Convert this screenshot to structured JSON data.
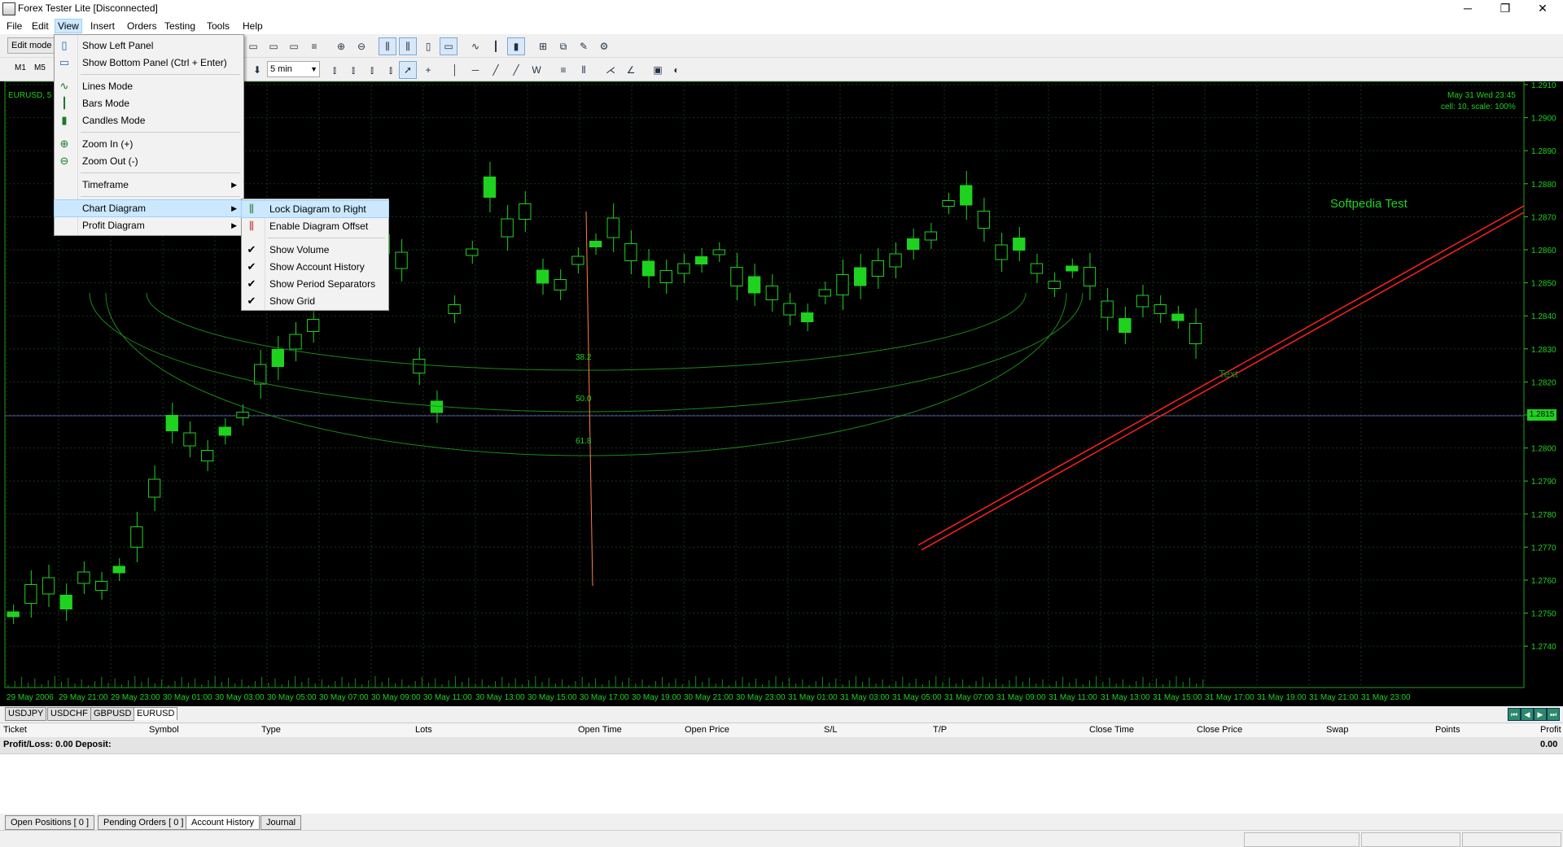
{
  "window": {
    "title": "Forex Tester Lite [Disconnected]",
    "min": "─",
    "max": "❐",
    "close": "✕"
  },
  "menubar": [
    "File",
    "Edit",
    "View",
    "Insert",
    "Orders",
    "Testing",
    "Tools",
    "Help"
  ],
  "toolbar": {
    "edit_mode": "Edit mode",
    "timeframes": [
      "M1",
      "M5"
    ],
    "timeframe_select": "5 min"
  },
  "view_menu": [
    {
      "label": "Show Left Panel",
      "icon": "left-panel-icon"
    },
    {
      "label": "Show Bottom Panel (Ctrl + Enter)",
      "icon": "bottom-panel-icon"
    },
    {
      "label": "Lines Mode",
      "icon": "lines-mode-icon"
    },
    {
      "label": "Bars Mode",
      "icon": "bars-mode-icon"
    },
    {
      "label": "Candles Mode",
      "icon": "candles-mode-icon"
    },
    {
      "label": "Zoom In (+)",
      "icon": "zoom-in-icon"
    },
    {
      "label": "Zoom Out (-)",
      "icon": "zoom-out-icon"
    },
    {
      "label": "Timeframe",
      "submenu": true
    },
    {
      "label": "Chart Diagram",
      "submenu": true,
      "highlighted": true
    },
    {
      "label": "Profit Diagram",
      "submenu": true
    }
  ],
  "chart_diagram_menu": [
    {
      "label": "Lock Diagram to Right",
      "icon": "lock-diagram-icon",
      "highlighted": true
    },
    {
      "label": "Enable Diagram Offset",
      "icon": "diagram-offset-icon"
    },
    {
      "label": "Show Volume",
      "checked": true
    },
    {
      "label": "Show Account History",
      "checked": true
    },
    {
      "label": "Show Period Separators",
      "checked": true
    },
    {
      "label": "Show Grid",
      "checked": true
    }
  ],
  "chart": {
    "symbol_label": "EURUSD, 5",
    "info_line1": "May 31 Wed 23:45",
    "info_line2": "cell: 10, scale: 100%",
    "current_price": "1.2815",
    "annotation_text": "Softpedia Test",
    "text_object": "Text",
    "fib_levels": [
      "38.2",
      "50.0",
      "61.8"
    ],
    "price_labels": [
      "1.2910",
      "1.2900",
      "1.2890",
      "1.2880",
      "1.2870",
      "1.2860",
      "1.2850",
      "1.2840",
      "1.2830",
      "1.2820",
      "1.2810",
      "1.2800",
      "1.2790",
      "1.2780",
      "1.2770",
      "1.2760",
      "1.2750",
      "1.2740"
    ],
    "time_labels": [
      "29 May 2006",
      "29 May 21:00",
      "29 May 23:00",
      "30 May 01:00",
      "30 May 03:00",
      "30 May 05:00",
      "30 May 07:00",
      "30 May 09:00",
      "30 May 11:00",
      "30 May 13:00",
      "30 May 15:00",
      "30 May 17:00",
      "30 May 19:00",
      "30 May 21:00",
      "30 May 23:00",
      "31 May 01:00",
      "31 May 03:00",
      "31 May 05:00",
      "31 May 07:00",
      "31 May 09:00",
      "31 May 11:00",
      "31 May 13:00",
      "31 May 15:00",
      "31 May 17:00",
      "31 May 19:00",
      "31 May 21:00",
      "31 May 23:00"
    ],
    "colors": {
      "background": "#000000",
      "candle": "#1fd21f",
      "trendline": "#ff2020",
      "vertical_line": "#ff8040"
    }
  },
  "symbol_tabs": [
    "USDJPY",
    "USDCHF",
    "GBPUSD",
    "EURUSD"
  ],
  "active_symbol": "EURUSD",
  "table": {
    "columns": [
      "Ticket",
      "Symbol",
      "Type",
      "Lots",
      "Open Time",
      "Open Price",
      "S/L",
      "T/P",
      "Close Time",
      "Close Price",
      "Swap",
      "Points",
      "Profit"
    ],
    "summary": "Profit/Loss: 0.00 Deposit:",
    "summary_value": "0.00"
  },
  "bottom_tabs": [
    "Open Positions  [ 0 ]",
    "Pending Orders  [ 0 ]",
    "Account History",
    "Journal"
  ],
  "active_bottom_tab": "Account History"
}
